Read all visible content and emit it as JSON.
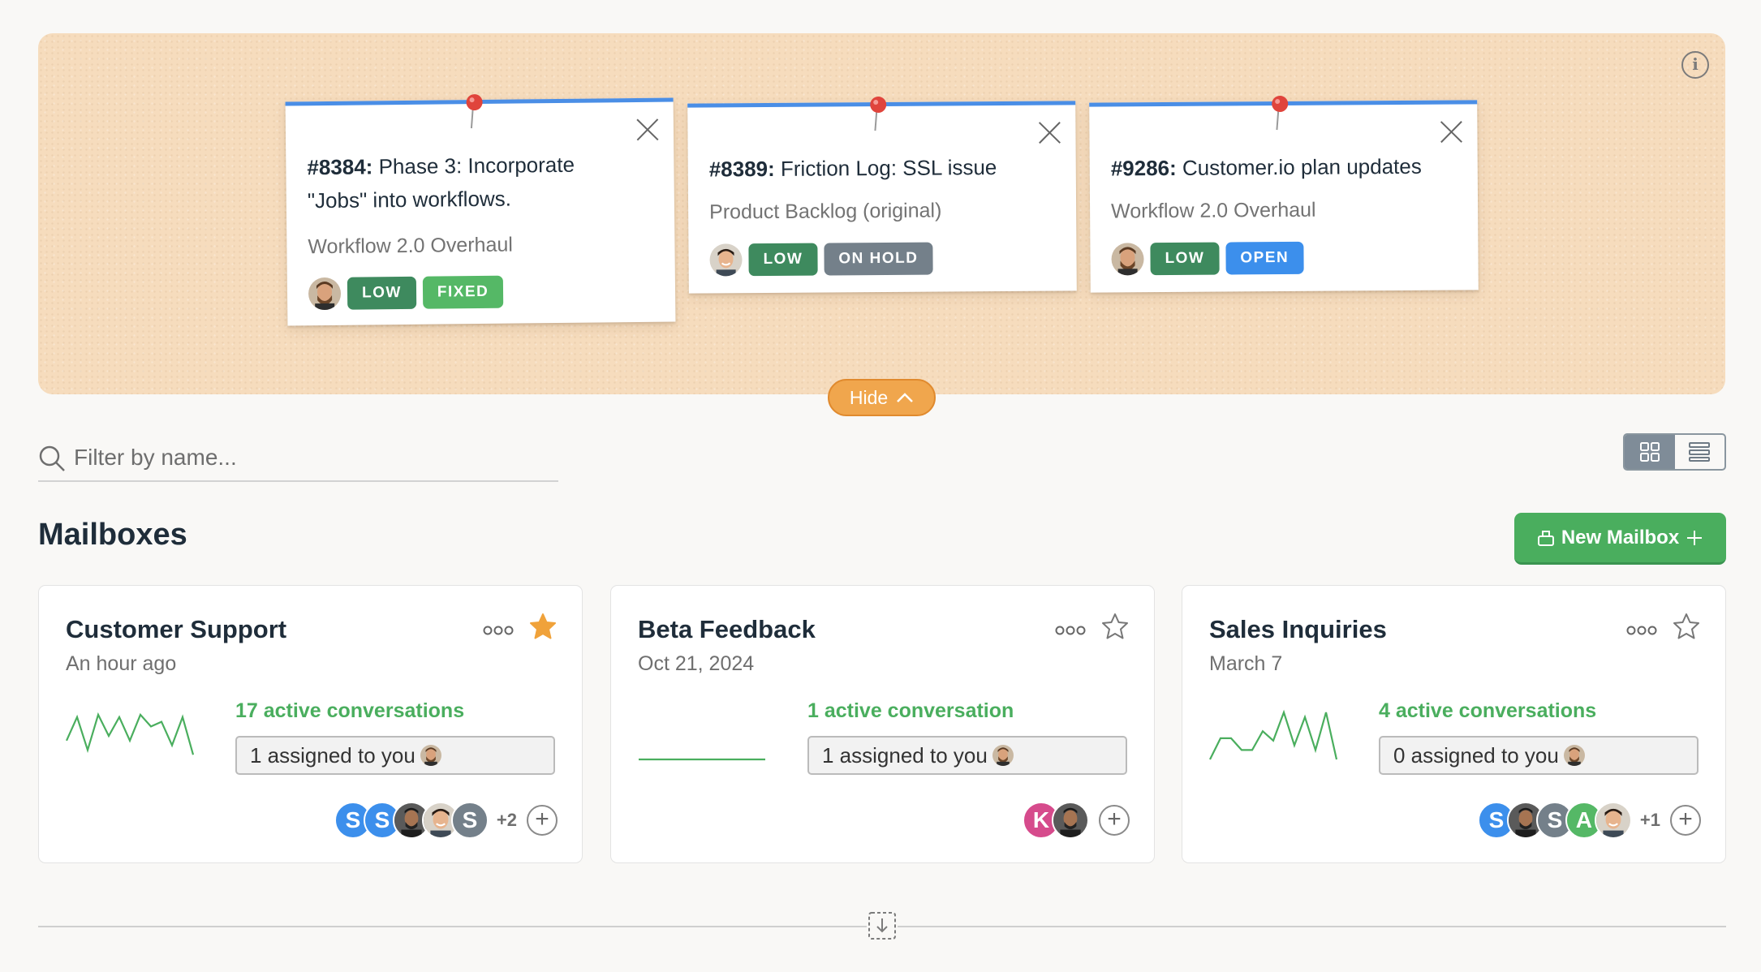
{
  "board": {
    "notes": [
      {
        "id": "#8384:",
        "title": "Phase 3: Incorporate \"Jobs\" into workflows.",
        "title_line1": "Phase 3: Incorporate",
        "title_line2": "\"Jobs\" into workflows.",
        "project": "Workflow 2.0 Overhaul",
        "priority": "LOW",
        "status": "FIXED"
      },
      {
        "id": "#8389:",
        "title": "Friction Log: SSL issue",
        "project": "Product Backlog (original)",
        "priority": "LOW",
        "status": "ON HOLD"
      },
      {
        "id": "#9286:",
        "title": "Customer.io plan updates",
        "project": "Workflow 2.0 Overhaul",
        "priority": "LOW",
        "status": "OPEN"
      }
    ],
    "hide_label": "Hide"
  },
  "filter": {
    "placeholder": "Filter by name..."
  },
  "section_title": "Mailboxes",
  "new_mailbox_label": "New Mailbox",
  "mailboxes": [
    {
      "name": "Customer Support",
      "date": "An hour ago",
      "active": "17 active conversations",
      "assigned": "1 assigned to you",
      "starred": true,
      "members": [
        "S",
        "S",
        "",
        "",
        "S"
      ],
      "more": "+2",
      "trend": [
        0.4,
        0.9,
        0.2,
        0.95,
        0.5,
        0.9,
        0.4,
        0.95,
        0.7,
        0.8,
        0.3,
        0.9,
        0.1
      ]
    },
    {
      "name": "Beta Feedback",
      "date": "Oct 21, 2024",
      "active": "1 active conversation",
      "assigned": "1 assigned to you",
      "starred": false,
      "members": [
        "K",
        ""
      ],
      "more": "",
      "trend": [
        0,
        0,
        0,
        0,
        0,
        0,
        0,
        0,
        0,
        0,
        0,
        0,
        0
      ]
    },
    {
      "name": "Sales Inquiries",
      "date": "March 7",
      "active": "4 active conversations",
      "assigned": "0 assigned to you",
      "starred": false,
      "members": [
        "S",
        "",
        "S",
        "A",
        ""
      ],
      "more": "+1",
      "trend": [
        0,
        0.45,
        0.45,
        0.2,
        0.2,
        0.6,
        0.4,
        1,
        0.3,
        0.9,
        0.2,
        1,
        0
      ]
    }
  ],
  "colors": {
    "accent_green": "#4aae5e",
    "pin_red": "#e0443c",
    "note_blue": "#4a8ee6",
    "star_orange": "#f0a23a",
    "avatar_blue": "#3c8fec",
    "avatar_grey": "#74808a",
    "avatar_green": "#55b866",
    "avatar_pink": "#d64b8c"
  },
  "icons": [
    "info-icon",
    "pushpin-icon",
    "close-icon",
    "chevron-up-icon",
    "search-icon",
    "grid-view-icon",
    "list-view-icon",
    "inbox-icon",
    "plus-icon",
    "more-icon",
    "star-icon",
    "add-member-icon",
    "expand-icon"
  ]
}
